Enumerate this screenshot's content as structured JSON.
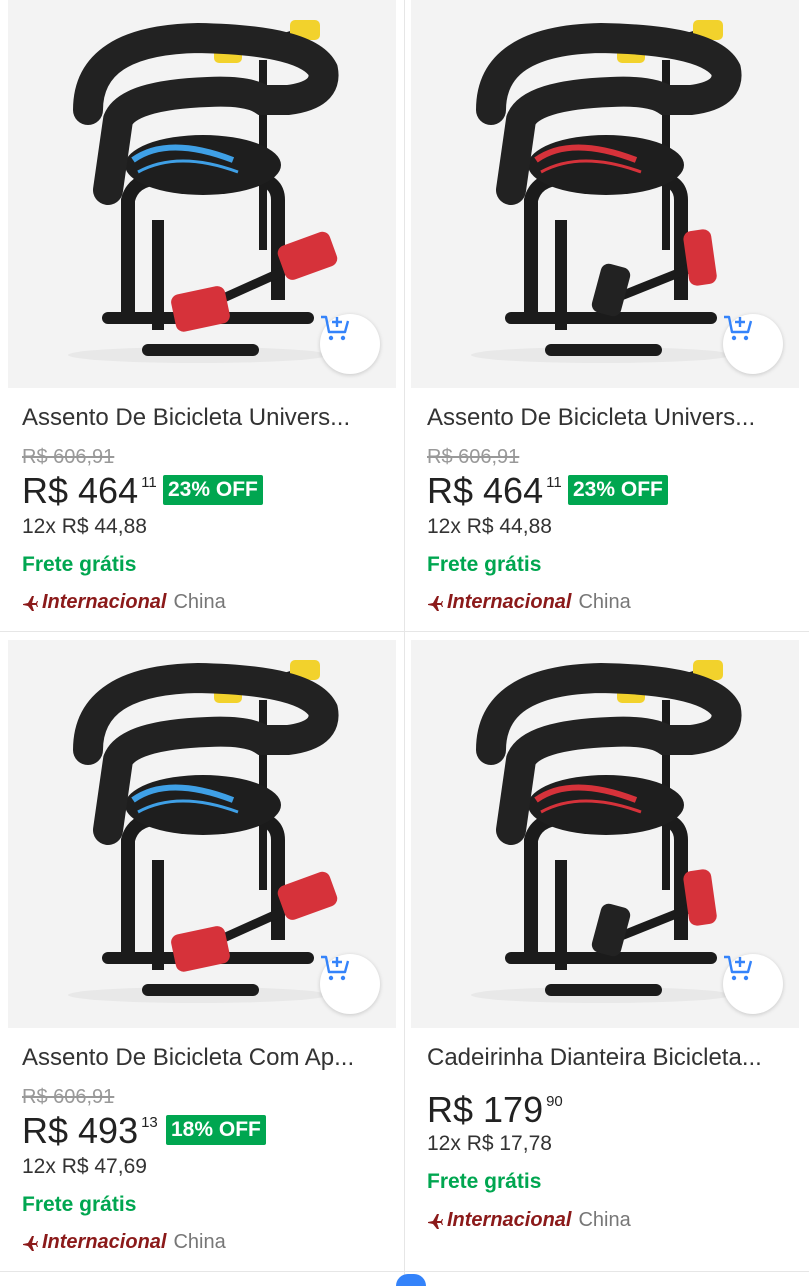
{
  "products": [
    {
      "title": "Assento De Bicicleta Univers...",
      "old_price": "R$ 606,91",
      "price_int": "R$ 464",
      "price_cents": "11",
      "discount": "23% OFF",
      "installments": "12x R$ 44,88",
      "shipping": "Frete grátis",
      "intl_label": "Internacional",
      "origin": "China",
      "seat_accent": "#3fa0e6"
    },
    {
      "title": "Assento De Bicicleta Univers...",
      "old_price": "R$ 606,91",
      "price_int": "R$ 464",
      "price_cents": "11",
      "discount": "23% OFF",
      "installments": "12x R$ 44,88",
      "shipping": "Frete grátis",
      "intl_label": "Internacional",
      "origin": "China",
      "seat_accent": "#d6323a"
    },
    {
      "title": "Assento De Bicicleta Com Ap...",
      "old_price": "R$ 606,91",
      "price_int": "R$ 493",
      "price_cents": "13",
      "discount": "18% OFF",
      "installments": "12x R$ 47,69",
      "shipping": "Frete grátis",
      "intl_label": "Internacional",
      "origin": "China",
      "seat_accent": "#3fa0e6"
    },
    {
      "title": "Cadeirinha Dianteira Bicicleta...",
      "price_int": "R$ 179",
      "price_cents": "90",
      "installments": "12x R$ 17,78",
      "shipping": "Frete grátis",
      "intl_label": "Internacional",
      "origin": "China",
      "seat_accent": "#d6323a"
    }
  ],
  "icons": {
    "cart": "add-to-cart-icon",
    "plane": "plane-icon"
  },
  "colors": {
    "discount_green": "#00a650",
    "international_red": "#8b1a1a",
    "accent_blue": "#3483fa"
  }
}
